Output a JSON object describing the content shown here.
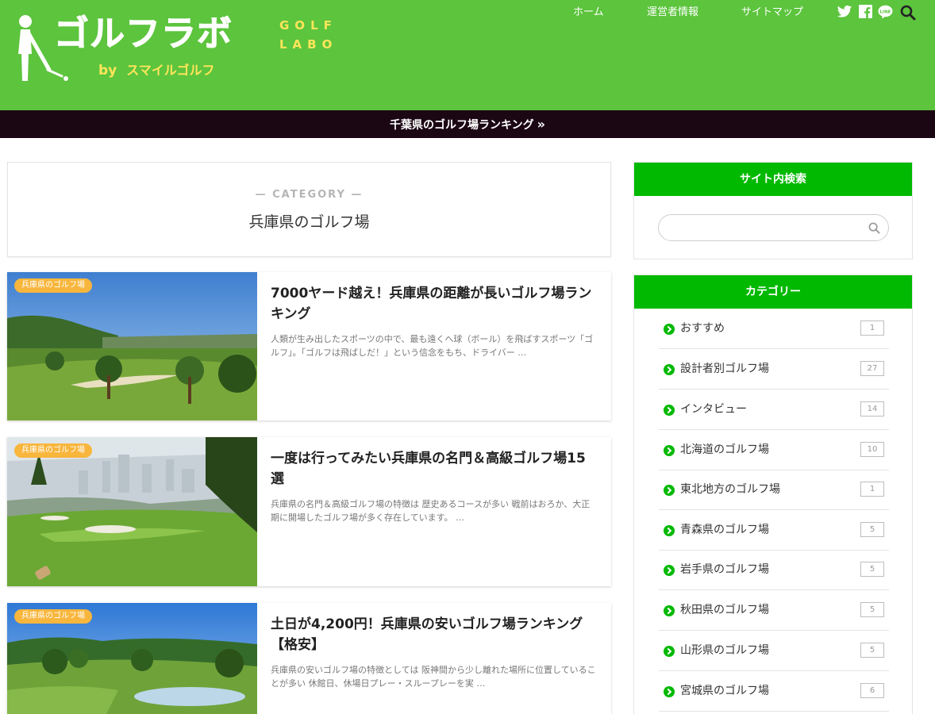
{
  "header": {
    "logo_main": "ゴルフラボ",
    "logo_golf": "GOLF",
    "logo_labo": "LABO",
    "logo_by": "by",
    "logo_sub": "スマイルゴルフ",
    "nav": [
      {
        "label": "ホーム"
      },
      {
        "label": "運営者情報"
      },
      {
        "label": "サイトマップ"
      }
    ],
    "icons": [
      "twitter-icon",
      "facebook-icon",
      "line-icon",
      "search-icon"
    ]
  },
  "banner": {
    "text": "千葉県のゴルフ場ランキング",
    "chevron": "»"
  },
  "category_box": {
    "label": "— CATEGORY —",
    "title": "兵庫県のゴルフ場"
  },
  "articles": [
    {
      "badge": "兵庫県のゴルフ場",
      "title": "7000ヤード越え！兵庫県の距離が長いゴルフ場ランキング",
      "excerpt": "人類が生み出したスポーツの中で、最も遠くへ球（ボール）を飛ばすスポーツ「ゴルフ」。「ゴルフは飛ばしだ！」という信念をもち、ドライバー …"
    },
    {
      "badge": "兵庫県のゴルフ場",
      "title": "一度は行ってみたい兵庫県の名門＆高級ゴルフ場15選",
      "excerpt": "兵庫県の名門＆高級ゴルフ場の特徴は 歴史あるコースが多い 戦前はおろか、大正期に開場したゴルフ場が多く存在しています。 …"
    },
    {
      "badge": "兵庫県のゴルフ場",
      "title": "土日が4,200円！兵庫県の安いゴルフ場ランキング【格安】",
      "excerpt": "兵庫県の安いゴルフ場の特徴としては 阪神間から少し離れた場所に位置していることが多い 休館日、休場日プレー・スループレーを実 …"
    }
  ],
  "sidebar": {
    "search": {
      "title": "サイト内検索",
      "placeholder": ""
    },
    "categories": {
      "title": "カテゴリー",
      "items": [
        {
          "name": "おすすめ",
          "count": "1"
        },
        {
          "name": "設計者別ゴルフ場",
          "count": "27"
        },
        {
          "name": "インタビュー",
          "count": "14"
        },
        {
          "name": "北海道のゴルフ場",
          "count": "10"
        },
        {
          "name": "東北地方のゴルフ場",
          "count": "1"
        },
        {
          "name": "青森県のゴルフ場",
          "count": "5"
        },
        {
          "name": "岩手県のゴルフ場",
          "count": "5"
        },
        {
          "name": "秋田県のゴルフ場",
          "count": "5"
        },
        {
          "name": "山形県のゴルフ場",
          "count": "5"
        },
        {
          "name": "宮城県のゴルフ場",
          "count": "6"
        }
      ]
    }
  },
  "colors": {
    "header_green": "#5cc43d",
    "widget_green": "#00b900",
    "banner_dark": "#1b0613",
    "badge_orange": "#f8b63d",
    "logo_yellow": "#ffe55a"
  }
}
